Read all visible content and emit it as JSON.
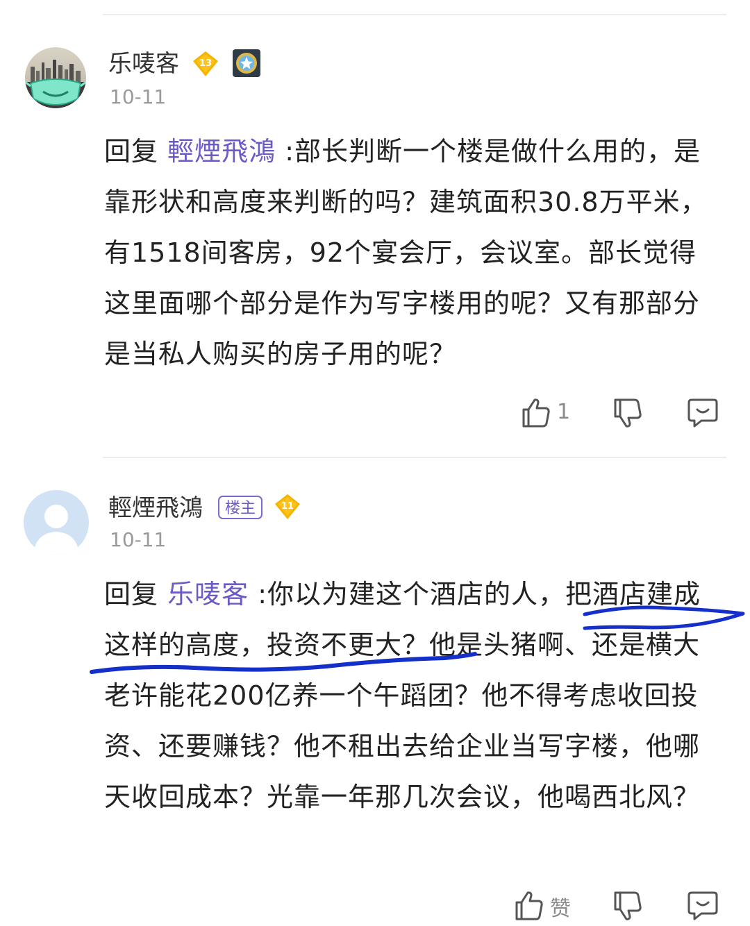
{
  "comments": [
    {
      "username": "乐唛客",
      "level": "13",
      "date": "10-11",
      "reply_prefix": "回复",
      "mention": "輕煙飛鴻",
      "text": " :部长判断一个楼是做什么用的，是靠形状和高度来判断的吗？建筑面积30.8万平米，有1518间客房，92个宴会厅，会议室。部长觉得这里面哪个部分是作为写字楼用的呢？又有那部分是当私人购买的房子用的呢？",
      "like_count": "1"
    },
    {
      "username": "輕煙飛鴻",
      "owner_badge": "楼主",
      "level": "11",
      "date": "10-11",
      "reply_prefix": "回复",
      "mention": "乐唛客",
      "text": " :你以为建这个酒店的人，把酒店建成这样的高度，投资不更大？他是头猪啊、还是横大老许能花200亿养一个午蹈团？他不得考虑收回投资、还要赚钱？他不租出去给企业当写字楼，他哪天收回成本？光靠一年那几次会议，他喝西北风？",
      "like_label": "赞"
    }
  ],
  "colors": {
    "mention": "#6a5bc6",
    "level_badge": "#f5b400",
    "annotation": "#1530c8"
  },
  "icons": [
    "avatar-city-mask",
    "level-badge-icon",
    "medal-icon",
    "thumbs-up-icon",
    "thumbs-down-icon",
    "comment-icon"
  ]
}
